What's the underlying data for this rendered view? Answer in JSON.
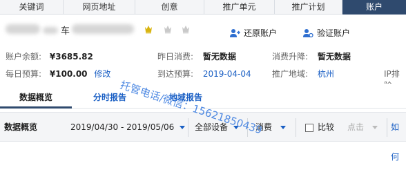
{
  "topnav": {
    "tabs": [
      {
        "label": "关键词",
        "active": false
      },
      {
        "label": "网页地址",
        "active": false
      },
      {
        "label": "创意",
        "active": false
      },
      {
        "label": "推广单元",
        "active": false
      },
      {
        "label": "推广计划",
        "active": false
      },
      {
        "label": "账户",
        "active": true
      }
    ]
  },
  "account": {
    "name_visible_char": "车",
    "tier_icons": [
      "crown-icon",
      "crown-icon",
      "crown-icon"
    ],
    "restore_label": "还原账户",
    "verify_label": "验证账户"
  },
  "info": {
    "balance_label": "账户余额:",
    "balance_value": "¥3685.82",
    "yesterday_label": "昨日消费:",
    "yesterday_value": "暂无数据",
    "rise_label": "消费升降:",
    "rise_value": "暂无数据",
    "budget_label": "每日预算:",
    "budget_value": "¥100.00",
    "budget_edit": "修改",
    "until_label": "到达预算:",
    "until_value": "2019-04-04",
    "region_label": "推广地域:",
    "region_value": "杭州",
    "ip_label": "IP排除"
  },
  "subtabs": [
    {
      "label": "数据概览",
      "active": true
    },
    {
      "label": "分时报告",
      "active": false
    },
    {
      "label": "地域报告",
      "active": false
    }
  ],
  "toolbar": {
    "title": "数据概览",
    "date_range": "2019/04/30 - 2019/05/06",
    "device": "全部设备",
    "metric": "消费",
    "compare": "比较",
    "click": "点击",
    "howto": "如何"
  },
  "watermark": "托管电话/微信：15621850439",
  "colors": {
    "nav_active": "#2f4a6e",
    "link_blue": "#1a5fc4",
    "toolbar_bg": "#f4f5f7"
  }
}
